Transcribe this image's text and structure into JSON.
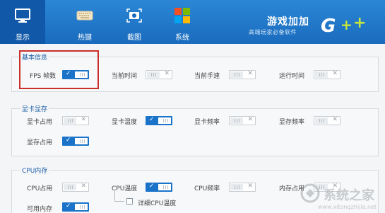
{
  "nav": {
    "tabs": [
      {
        "label": "显示",
        "icon": "monitor-icon",
        "active": true
      },
      {
        "label": "热键",
        "icon": "keyboard-icon",
        "active": false
      },
      {
        "label": "截图",
        "icon": "camera-icon",
        "active": false
      },
      {
        "label": "系统",
        "icon": "system-grid-icon",
        "active": false
      }
    ]
  },
  "brand": {
    "title": "游戏加加",
    "subtitle": "高端玩家必备软件",
    "logo_text": "G++"
  },
  "sections": {
    "basic": {
      "title": "基本信息",
      "items": [
        {
          "label": "FPS 帧数",
          "on": true
        },
        {
          "label": "当前时间",
          "on": false
        },
        {
          "label": "当前手速",
          "on": false
        },
        {
          "label": "运行时间",
          "on": false
        }
      ]
    },
    "gpu": {
      "title": "显卡显存",
      "items": [
        {
          "label": "显卡占用",
          "on": false
        },
        {
          "label": "显卡温度",
          "on": true
        },
        {
          "label": "显卡频率",
          "on": false
        },
        {
          "label": "显存频率",
          "on": false
        },
        {
          "label": "显存占用",
          "on": true
        }
      ]
    },
    "cpu": {
      "title": "CPU内存",
      "items": [
        {
          "label": "CPU占用",
          "on": false
        },
        {
          "label": "CPU温度",
          "on": true
        },
        {
          "label": "CPU频率",
          "on": false
        },
        {
          "label": "内存占用",
          "on": false
        },
        {
          "label": "可用内存",
          "on": true
        }
      ],
      "detail_checkbox": "详细CPU温度"
    }
  },
  "toggle_marks": {
    "on": "✓",
    "off": "✕"
  },
  "watermark": {
    "text": "系统之家",
    "url": "www.xitongzhijia.net"
  },
  "colors": {
    "header": "#1a6bbd",
    "active_tab": "#1159a8",
    "toggle_on": "#1a73c9",
    "highlight": "#c9302c"
  }
}
